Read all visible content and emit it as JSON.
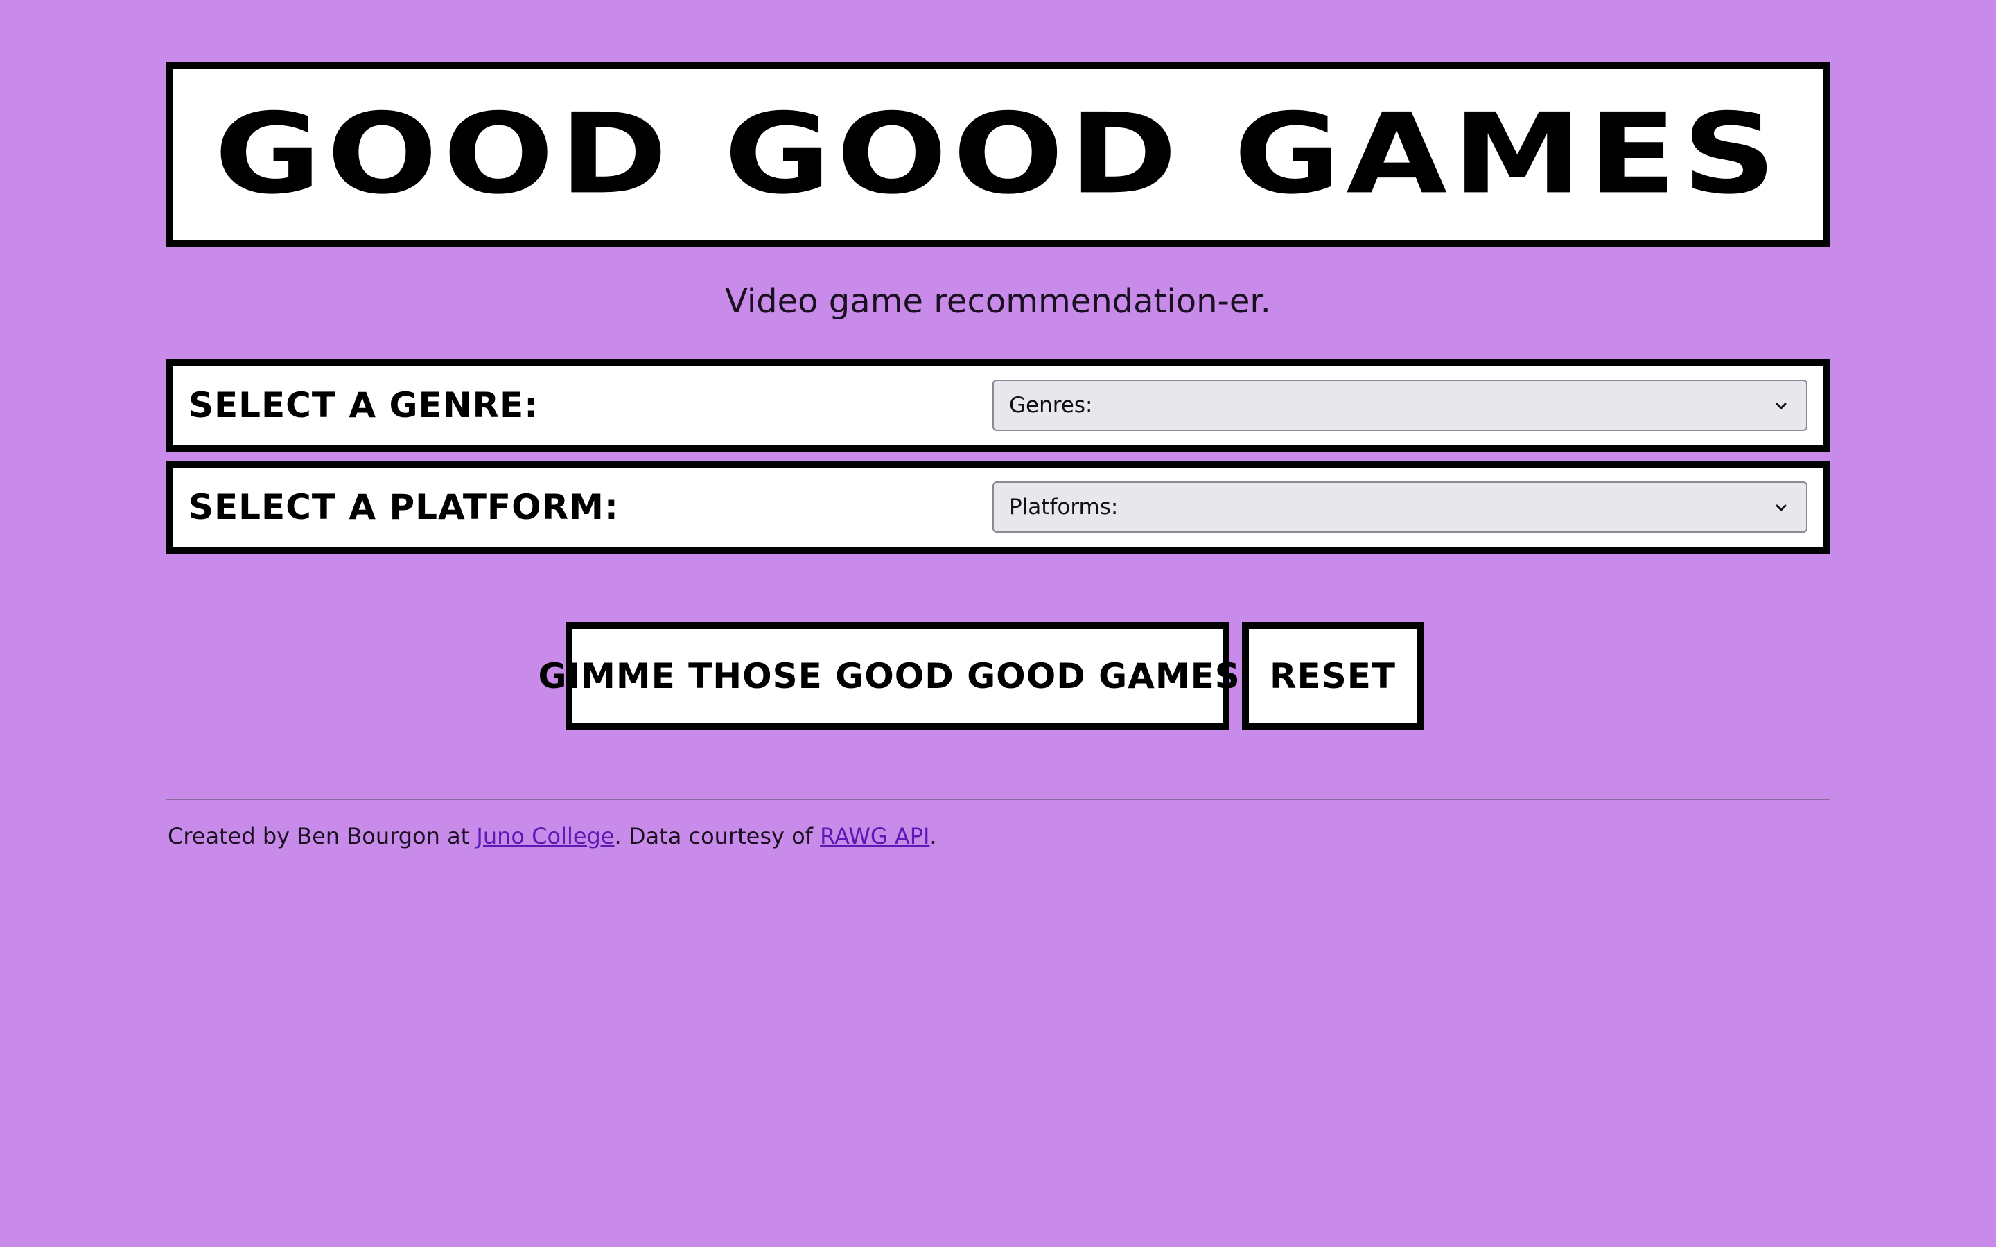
{
  "header": {
    "title": "Good Good Games",
    "tagline": "Video game recommendation-er."
  },
  "form": {
    "genre": {
      "label": "Select a genre:",
      "selected": "Genres:"
    },
    "platform": {
      "label": "Select a platform:",
      "selected": "Platforms:"
    },
    "submit_label": "Gimme those good good games!",
    "reset_label": "Reset"
  },
  "footer": {
    "prefix": "Created by Ben Bourgon at ",
    "link1": "Juno College",
    "middle": ". Data courtesy of ",
    "link2": "RAWG API",
    "suffix": "."
  },
  "icons": {
    "dropdown": "chevron-down-icon"
  },
  "colors": {
    "background": "#c98be9",
    "panel": "#ffffff",
    "border": "#000000",
    "select_bg": "#e8e7ec",
    "link": "#5a1ab4"
  }
}
